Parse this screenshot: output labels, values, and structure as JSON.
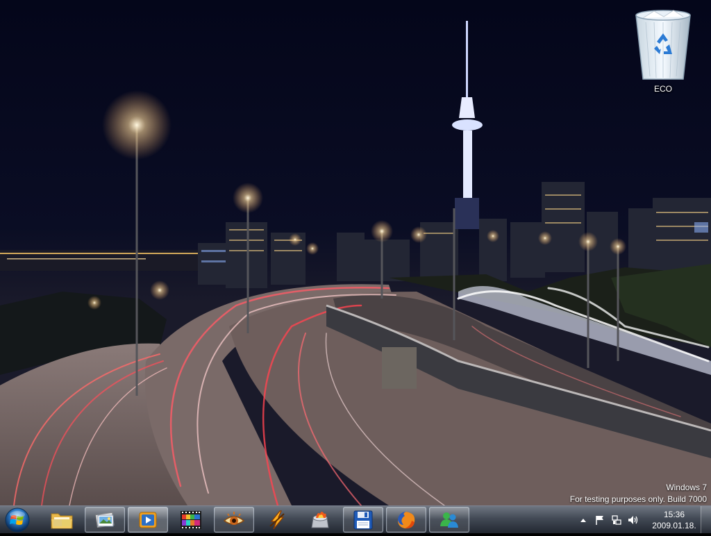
{
  "desktop": {
    "icons": [
      {
        "label": "ECO",
        "icon": "recycle-bin-icon"
      }
    ],
    "watermark": {
      "line1": "Windows 7",
      "line2": "For testing purposes only. Build 7000"
    }
  },
  "taskbar": {
    "start": {
      "icon": "windows-orb-icon"
    },
    "buttons": [
      {
        "icon": "explorer-folder-icon",
        "state": "pinned"
      },
      {
        "icon": "picture-viewer-icon",
        "state": "open"
      },
      {
        "icon": "media-player-icon",
        "state": "active"
      },
      {
        "icon": "film-strip-icon",
        "state": "pinned"
      },
      {
        "icon": "eye-app-icon",
        "state": "open"
      },
      {
        "icon": "lightning-app-icon",
        "state": "pinned"
      },
      {
        "icon": "disc-burner-icon",
        "state": "pinned"
      },
      {
        "icon": "floppy-disk-icon",
        "state": "pinned"
      },
      {
        "icon": "firefox-icon",
        "state": "open"
      },
      {
        "icon": "messenger-icon",
        "state": "open"
      }
    ],
    "tray": {
      "icons": [
        "show-hidden-icons-arrow",
        "action-center-flag-icon",
        "network-icon",
        "volume-icon"
      ],
      "time": "15:36",
      "date": "2009.01.18."
    }
  }
}
